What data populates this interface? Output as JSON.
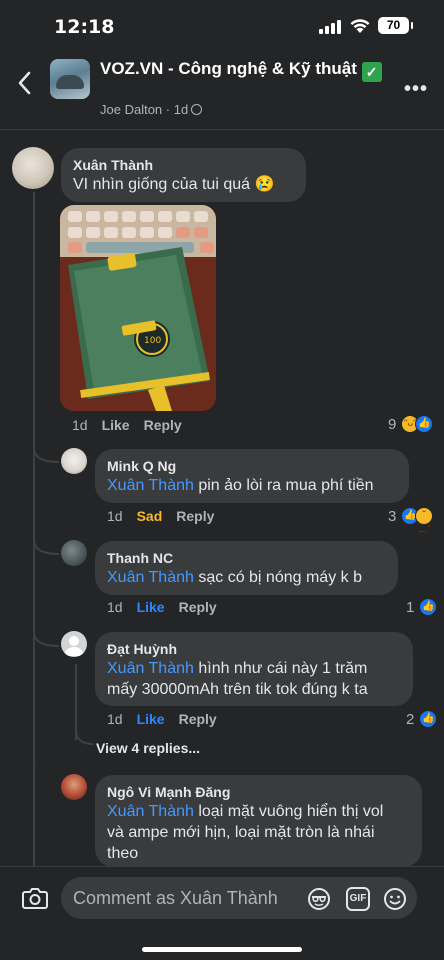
{
  "status": {
    "time": "12:18",
    "battery": "70"
  },
  "header": {
    "title": "VOZ.VN - Công nghệ & Kỹ thuật",
    "verified": "✓",
    "poster": "Joe Dalton",
    "age": "1d",
    "more": "•••"
  },
  "comments": [
    {
      "author": "Xuân Thành",
      "text": "VI nhìn giống của tui quá",
      "emoji": "😢",
      "time": "1d",
      "like": "Like",
      "reply": "Reply",
      "reaction_count": "9"
    },
    {
      "author": "Mink Q Ng",
      "mention": "Xuân Thành",
      "text": "pin ảo lòi ra mua phí tiền",
      "time": "1d",
      "reaction_label": "Sad",
      "reply": "Reply",
      "reaction_count": "3"
    },
    {
      "author": "Thanh NC",
      "mention": "Xuân Thành",
      "text": "sạc có bị nóng máy k b",
      "time": "1d",
      "like": "Like",
      "reply": "Reply",
      "reaction_count": "1"
    },
    {
      "author": "Đạt Huỳnh",
      "mention": "Xuân Thành",
      "text": "hình như cái này 1 trăm",
      "text2": "mấy 30000mAh trên tik tok đúng k ta",
      "time": "1d",
      "like": "Like",
      "reply": "Reply",
      "reaction_count": "2"
    },
    {
      "author": "Ngô Vi Mạnh Đăng",
      "mention": "Xuân Thành",
      "text": "loại mặt vuông hiển thị vol",
      "text2": "và ampe mới hịn, loại mặt tròn là nhái",
      "text3": "theo"
    }
  ],
  "view_replies": "View 4 replies...",
  "composer": {
    "placeholder": "Comment as Xuân Thành",
    "gif": "GIF"
  },
  "colors": {
    "background": "#242526",
    "bubble": "#3a3b3c",
    "mention": "#4599ff",
    "like_blue": "#2d88ff",
    "sad_yellow": "#f7b928"
  }
}
